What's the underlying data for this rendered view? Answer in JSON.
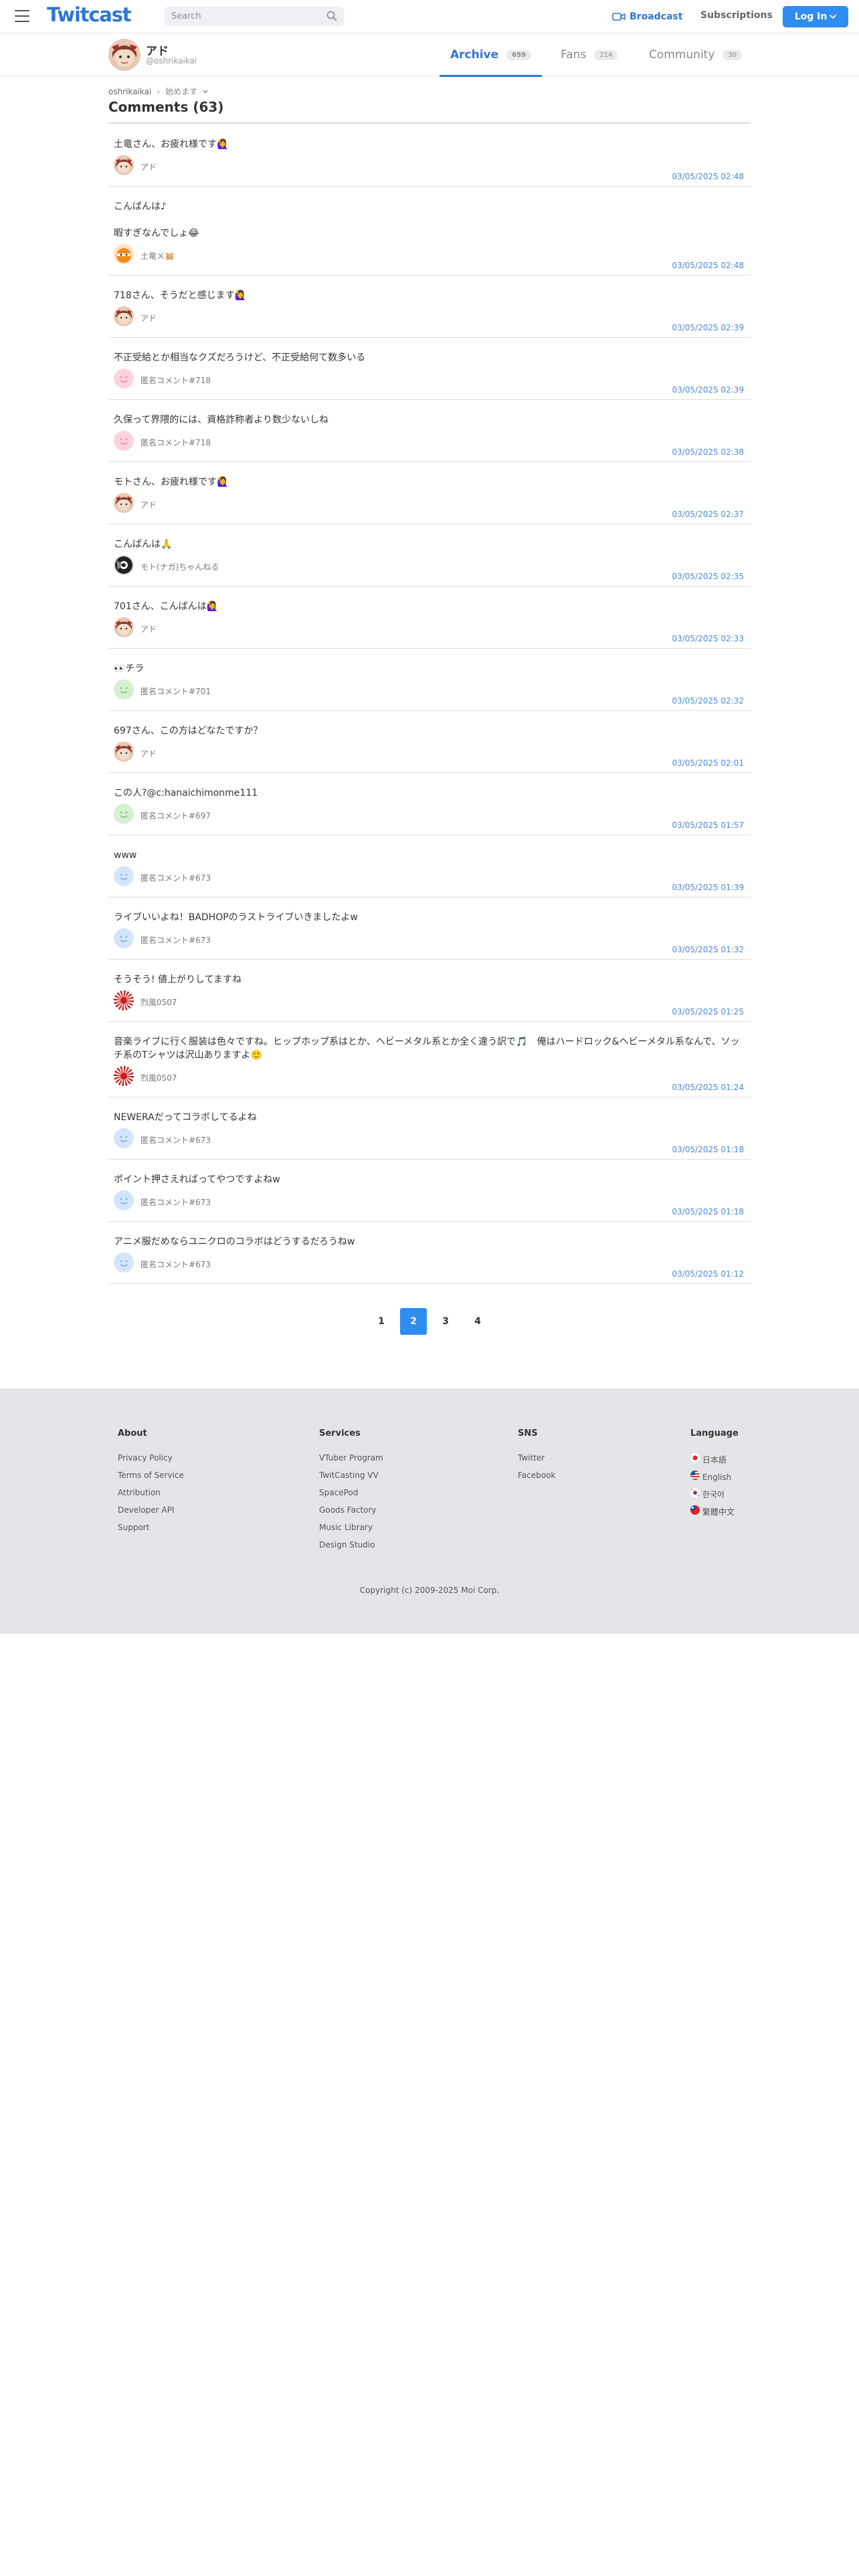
{
  "header": {
    "logo": "Twitcast",
    "search_placeholder": "Search",
    "broadcast_label": "Broadcast",
    "subscriptions_label": "Subscriptions",
    "login_label": "Log In"
  },
  "profile": {
    "name": "アド",
    "handle": "@oshrikaikai",
    "tabs": [
      {
        "label": "Archive",
        "count": "659"
      },
      {
        "label": "Fans",
        "count": "214"
      },
      {
        "label": "Community",
        "count": "30"
      }
    ]
  },
  "breadcrumb": {
    "user": "oshrikaikai",
    "separator": "›",
    "current": "始めます"
  },
  "page_title": "Comments (63)",
  "comments": [
    {
      "text": "土竜さん、お疲れ様です🙋‍♀️",
      "user": "アド",
      "time": "03/05/2025 02:48",
      "avatar": "ado"
    },
    {
      "text": "こんばんは♪\n\n暇すぎなんでしょ😂",
      "user": "土竜ㄨ🐹",
      "time": "03/05/2025 02:48",
      "avatar": "orange"
    },
    {
      "text": "718さん、そうだと感じます🙋‍♀️",
      "user": "アド",
      "time": "03/05/2025 02:39",
      "avatar": "ado"
    },
    {
      "text": "不正受給とか相当なクズだろうけど、不正受給何て数多いる",
      "user": "匿名コメント#718",
      "time": "03/05/2025 02:39",
      "avatar": "anon-pink"
    },
    {
      "text": "久保って界隈的には、資格詐称者より数少ないしね",
      "user": "匿名コメント#718",
      "time": "03/05/2025 02:38",
      "avatar": "anon-pink"
    },
    {
      "text": "モトさん、お疲れ様です🙋‍♀️",
      "user": "アド",
      "time": "03/05/2025 02:37",
      "avatar": "ado"
    },
    {
      "text": "こんばんは🙏",
      "user": "モト(ナガ)ちゃんねる",
      "time": "03/05/2025 02:35",
      "avatar": "dark"
    },
    {
      "text": "701さん、こんばんは🙋‍♀️",
      "user": "アド",
      "time": "03/05/2025 02:33",
      "avatar": "ado"
    },
    {
      "text": "👀チラ",
      "user": "匿名コメント#701",
      "time": "03/05/2025 02:32",
      "avatar": "anon-green"
    },
    {
      "text": "697さん、この方はどなたですか？",
      "user": "アド",
      "time": "03/05/2025 02:01",
      "avatar": "ado"
    },
    {
      "text": "この人?@c:hanaichimonme111",
      "user": "匿名コメント#697",
      "time": "03/05/2025 01:57",
      "avatar": "anon-green"
    },
    {
      "text": "www",
      "user": "匿名コメント#673",
      "time": "03/05/2025 01:39",
      "avatar": "anon-blue"
    },
    {
      "text": "ライブいいよね！BADHOPのラストライブいきましたよw",
      "user": "匿名コメント#673",
      "time": "03/05/2025 01:32",
      "avatar": "anon-blue"
    },
    {
      "text": "そうそう! 値上がりしてますね",
      "user": "烈風0507",
      "time": "03/05/2025 01:25",
      "avatar": "rays"
    },
    {
      "text": "音楽ライブに行く服装は色々ですね。ヒップホップ系はとか、ヘビーメタル系とか全く違う訳で🎵　俺はハードロック&ヘビーメタル系なんで、ソッチ系のTシャツは沢山ありますよ🙂",
      "user": "烈風0507",
      "time": "03/05/2025 01:24",
      "avatar": "rays"
    },
    {
      "text": "NEWERAだってコラボしてるよね",
      "user": "匿名コメント#673",
      "time": "03/05/2025 01:18",
      "avatar": "anon-blue"
    },
    {
      "text": "ポイント押さえればってやつですよねw",
      "user": "匿名コメント#673",
      "time": "03/05/2025 01:18",
      "avatar": "anon-blue"
    },
    {
      "text": "アニメ服だめならユニクロのコラボはどうするだろうねw",
      "user": "匿名コメント#673",
      "time": "03/05/2025 01:12",
      "avatar": "anon-blue"
    }
  ],
  "pagination": {
    "pages": [
      "1",
      "2",
      "3",
      "4"
    ],
    "current": "2"
  },
  "footer": {
    "about": {
      "title": "About",
      "links": [
        "Privacy Policy",
        "Terms of Service",
        "Attribution",
        "Developer API",
        "Support"
      ]
    },
    "services": {
      "title": "Services",
      "links": [
        "VTuber Program",
        "TwitCasting VV",
        "SpacePod",
        "Goods Factory",
        "Music Library",
        "Design Studio"
      ]
    },
    "sns": {
      "title": "SNS",
      "links": [
        "Twitter",
        "Facebook"
      ]
    },
    "language": {
      "title": "Language",
      "links": [
        {
          "label": "日本語",
          "flag": "jp-flag-icon"
        },
        {
          "label": "English",
          "flag": "us-flag-icon"
        },
        {
          "label": "한국어",
          "flag": "kr-flag-icon"
        },
        {
          "label": "繁體中文",
          "flag": "tw-flag-icon"
        }
      ]
    },
    "copyright": "Copyright (c) 2009-2025 Moi Corp."
  },
  "colors": {
    "accent": "#2f76d2",
    "button": "#2f8cf0",
    "timestamp": "#4a8bd6",
    "footer_bg": "#e4e5e8"
  }
}
